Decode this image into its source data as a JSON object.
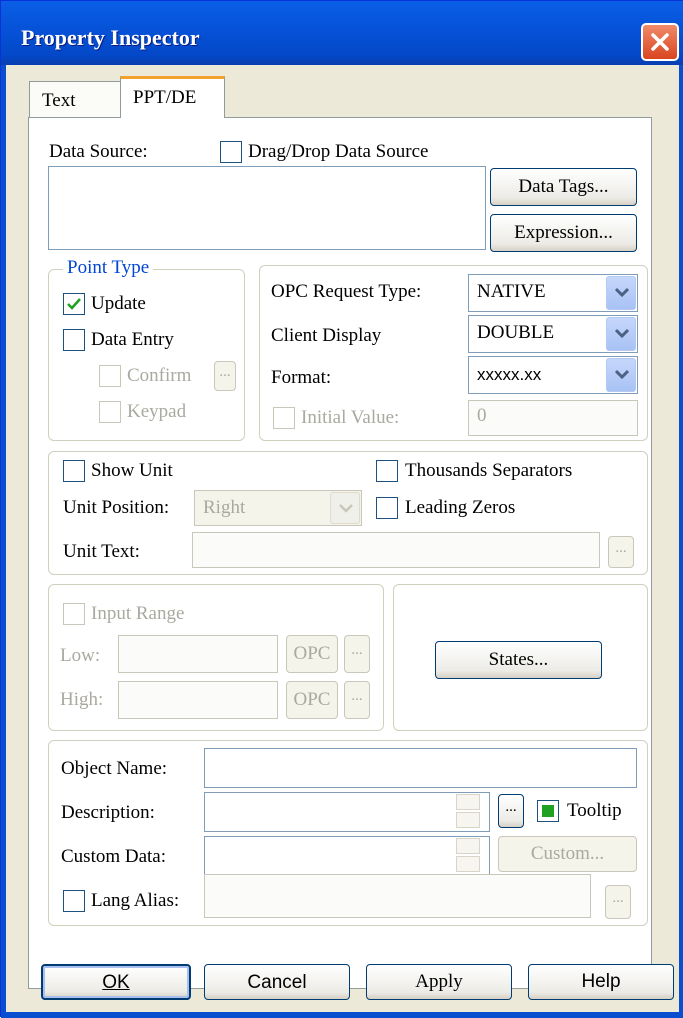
{
  "window": {
    "title": "Property Inspector"
  },
  "tabs": [
    {
      "label": "Text",
      "active": false
    },
    {
      "label": "PPT/DE",
      "active": true
    }
  ],
  "data_source": {
    "label": "Data Source:",
    "drag_drop_label": "Drag/Drop Data Source",
    "drag_drop_checked": false,
    "value": "",
    "data_tags_button": "Data Tags...",
    "expression_button": "Expression..."
  },
  "point_type": {
    "legend": "Point Type",
    "update_label": "Update",
    "update_checked": true,
    "data_entry_label": "Data Entry",
    "data_entry_checked": false,
    "confirm_label": "Confirm",
    "keypad_label": "Keypad",
    "ellipsis": "..."
  },
  "opc": {
    "request_type_label": "OPC Request Type:",
    "request_type_value": "NATIVE",
    "client_display_label": "Client Display",
    "client_display_value": "DOUBLE",
    "format_label": "Format:",
    "format_value": "xxxxx.xx",
    "initial_value_label": "Initial Value:",
    "initial_value": "0"
  },
  "units": {
    "show_unit_label": "Show Unit",
    "thousands_label": "Thousands Separators",
    "unit_position_label": "Unit Position:",
    "unit_position_value": "Right",
    "leading_zeros_label": "Leading Zeros",
    "unit_text_label": "Unit Text:",
    "unit_text_value": "",
    "ellipsis": "..."
  },
  "range": {
    "input_range_label": "Input Range",
    "low_label": "Low:",
    "high_label": "High:",
    "opc_label": "OPC",
    "ellipsis": "...",
    "states_button": "States..."
  },
  "object": {
    "name_label": "Object Name:",
    "name_value": "",
    "description_label": "Description:",
    "description_value": "",
    "ellipsis": "...",
    "tooltip_label": "Tooltip",
    "custom_data_label": "Custom Data:",
    "custom_button": "Custom...",
    "lang_alias_label": "Lang Alias:",
    "lang_alias_value": ""
  },
  "footer": {
    "ok": "OK",
    "cancel": "Cancel",
    "apply": "Apply",
    "help": "Help"
  },
  "colors": {
    "titlebar": "#0653d9",
    "dialog_bg": "#ece9d8",
    "active_tab_accent": "#f2a22c",
    "close_button": "#d9451f",
    "checkmark": "#21a121",
    "legend_text": "#0046d5"
  }
}
